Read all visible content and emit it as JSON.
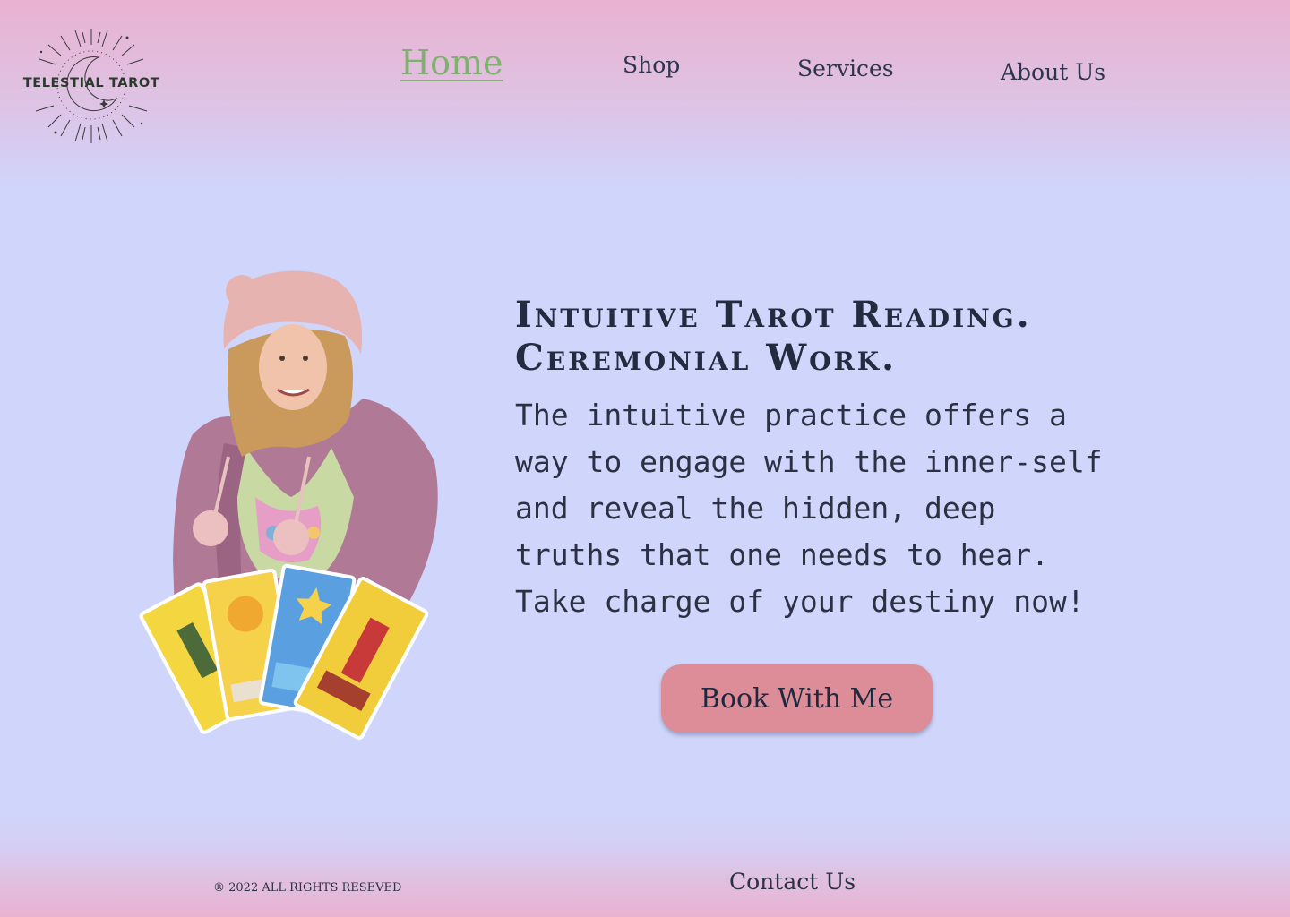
{
  "brand": {
    "logo_text": "TELESTIAL TAROT"
  },
  "nav": {
    "items": [
      {
        "label": "Home",
        "active": true
      },
      {
        "label": "Shop",
        "active": false
      },
      {
        "label": "Services",
        "active": false
      },
      {
        "label": "About Us",
        "active": false
      }
    ]
  },
  "hero": {
    "headline_lines": [
      "Intuitive Tarot Reading.",
      "Ceremonial Work."
    ],
    "body_lines": [
      "The intuitive practice offers a",
      "way to engage with the inner-self",
      "and reveal the hidden,  deep",
      "truths that one needs to hear.",
      "Take charge of your destiny now!"
    ],
    "cta_label": "Book With Me"
  },
  "footer": {
    "copyright": "® 2022 ALL RIGHTS RESEVED",
    "contact_label": "Contact Us"
  },
  "colors": {
    "active_nav": "#7fb06e",
    "cta_background": "#dc8d98",
    "page_mid": "#d0d5fb",
    "page_edge": "#e9b2d2"
  },
  "icons": {
    "logo": "sunburst-moon-logo",
    "portrait": "woman-with-tarot-cards-photo"
  }
}
